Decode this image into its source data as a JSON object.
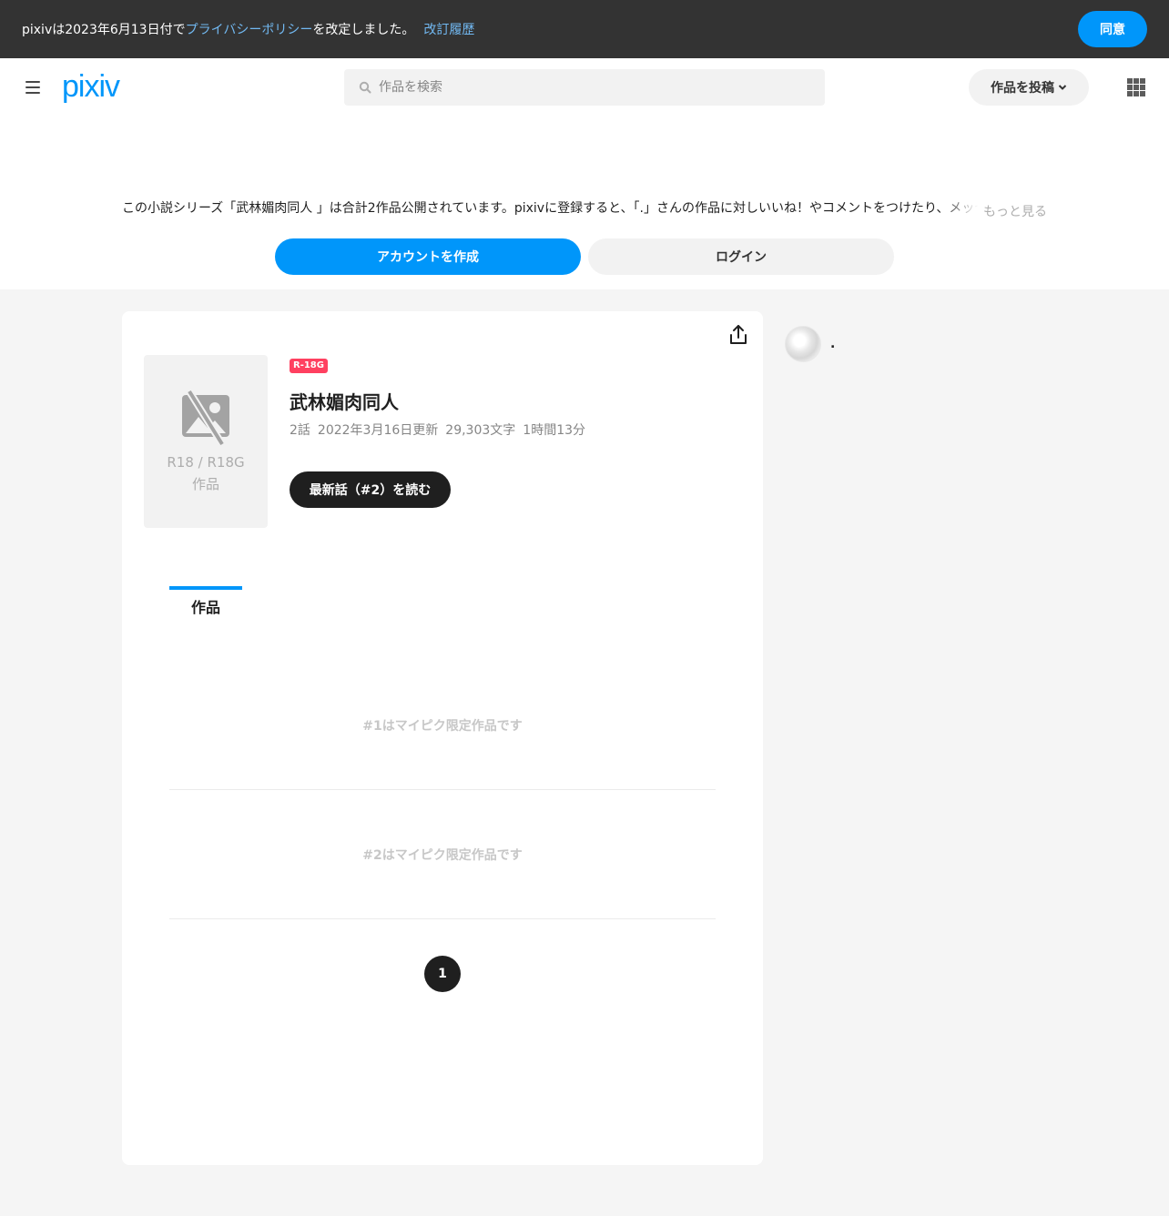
{
  "notice": {
    "prefix": "pixivは2023年6月13日付で",
    "policy_link": "プライバシーポリシー",
    "suffix": "を改定しました。",
    "history_link": "改訂履歴",
    "agree_label": "同意"
  },
  "header": {
    "logo": "pixiv",
    "search_placeholder": "作品を検索",
    "post_label": "作品を投稿"
  },
  "promo": {
    "text": "この小説シリーズ「武林媚肉同人 」は合計2作品公開されています。pixivに登録すると、「.」さんの作品に対しいいね！やコメントをつけたり、メッセージを送り交流することができます。",
    "more_label": "もっと見る",
    "create_label": "アカウントを作成",
    "login_label": "ログイン"
  },
  "series": {
    "cover_label": "R18 / R18G\n作品",
    "cover_line1": "R18 / R18G",
    "cover_line2": "作品",
    "badge": "R-18G",
    "title": "武林媚肉同人",
    "episodes_count": "2話",
    "updated": "2022年3月16日更新",
    "chars": "29,303文字",
    "reading_time": "1時間13分",
    "read_latest_label": "最新話（#2）を読む"
  },
  "tabs": {
    "works_label": "作品"
  },
  "episodes": [
    {
      "label": "#1はマイピク限定作品です"
    },
    {
      "label": "#2はマイピク限定作品です"
    }
  ],
  "pagination": {
    "current": "1"
  },
  "author": {
    "name": "."
  },
  "colors": {
    "accent": "#0096fa",
    "badge": "#ff4060",
    "dark": "#1f1f1f"
  }
}
